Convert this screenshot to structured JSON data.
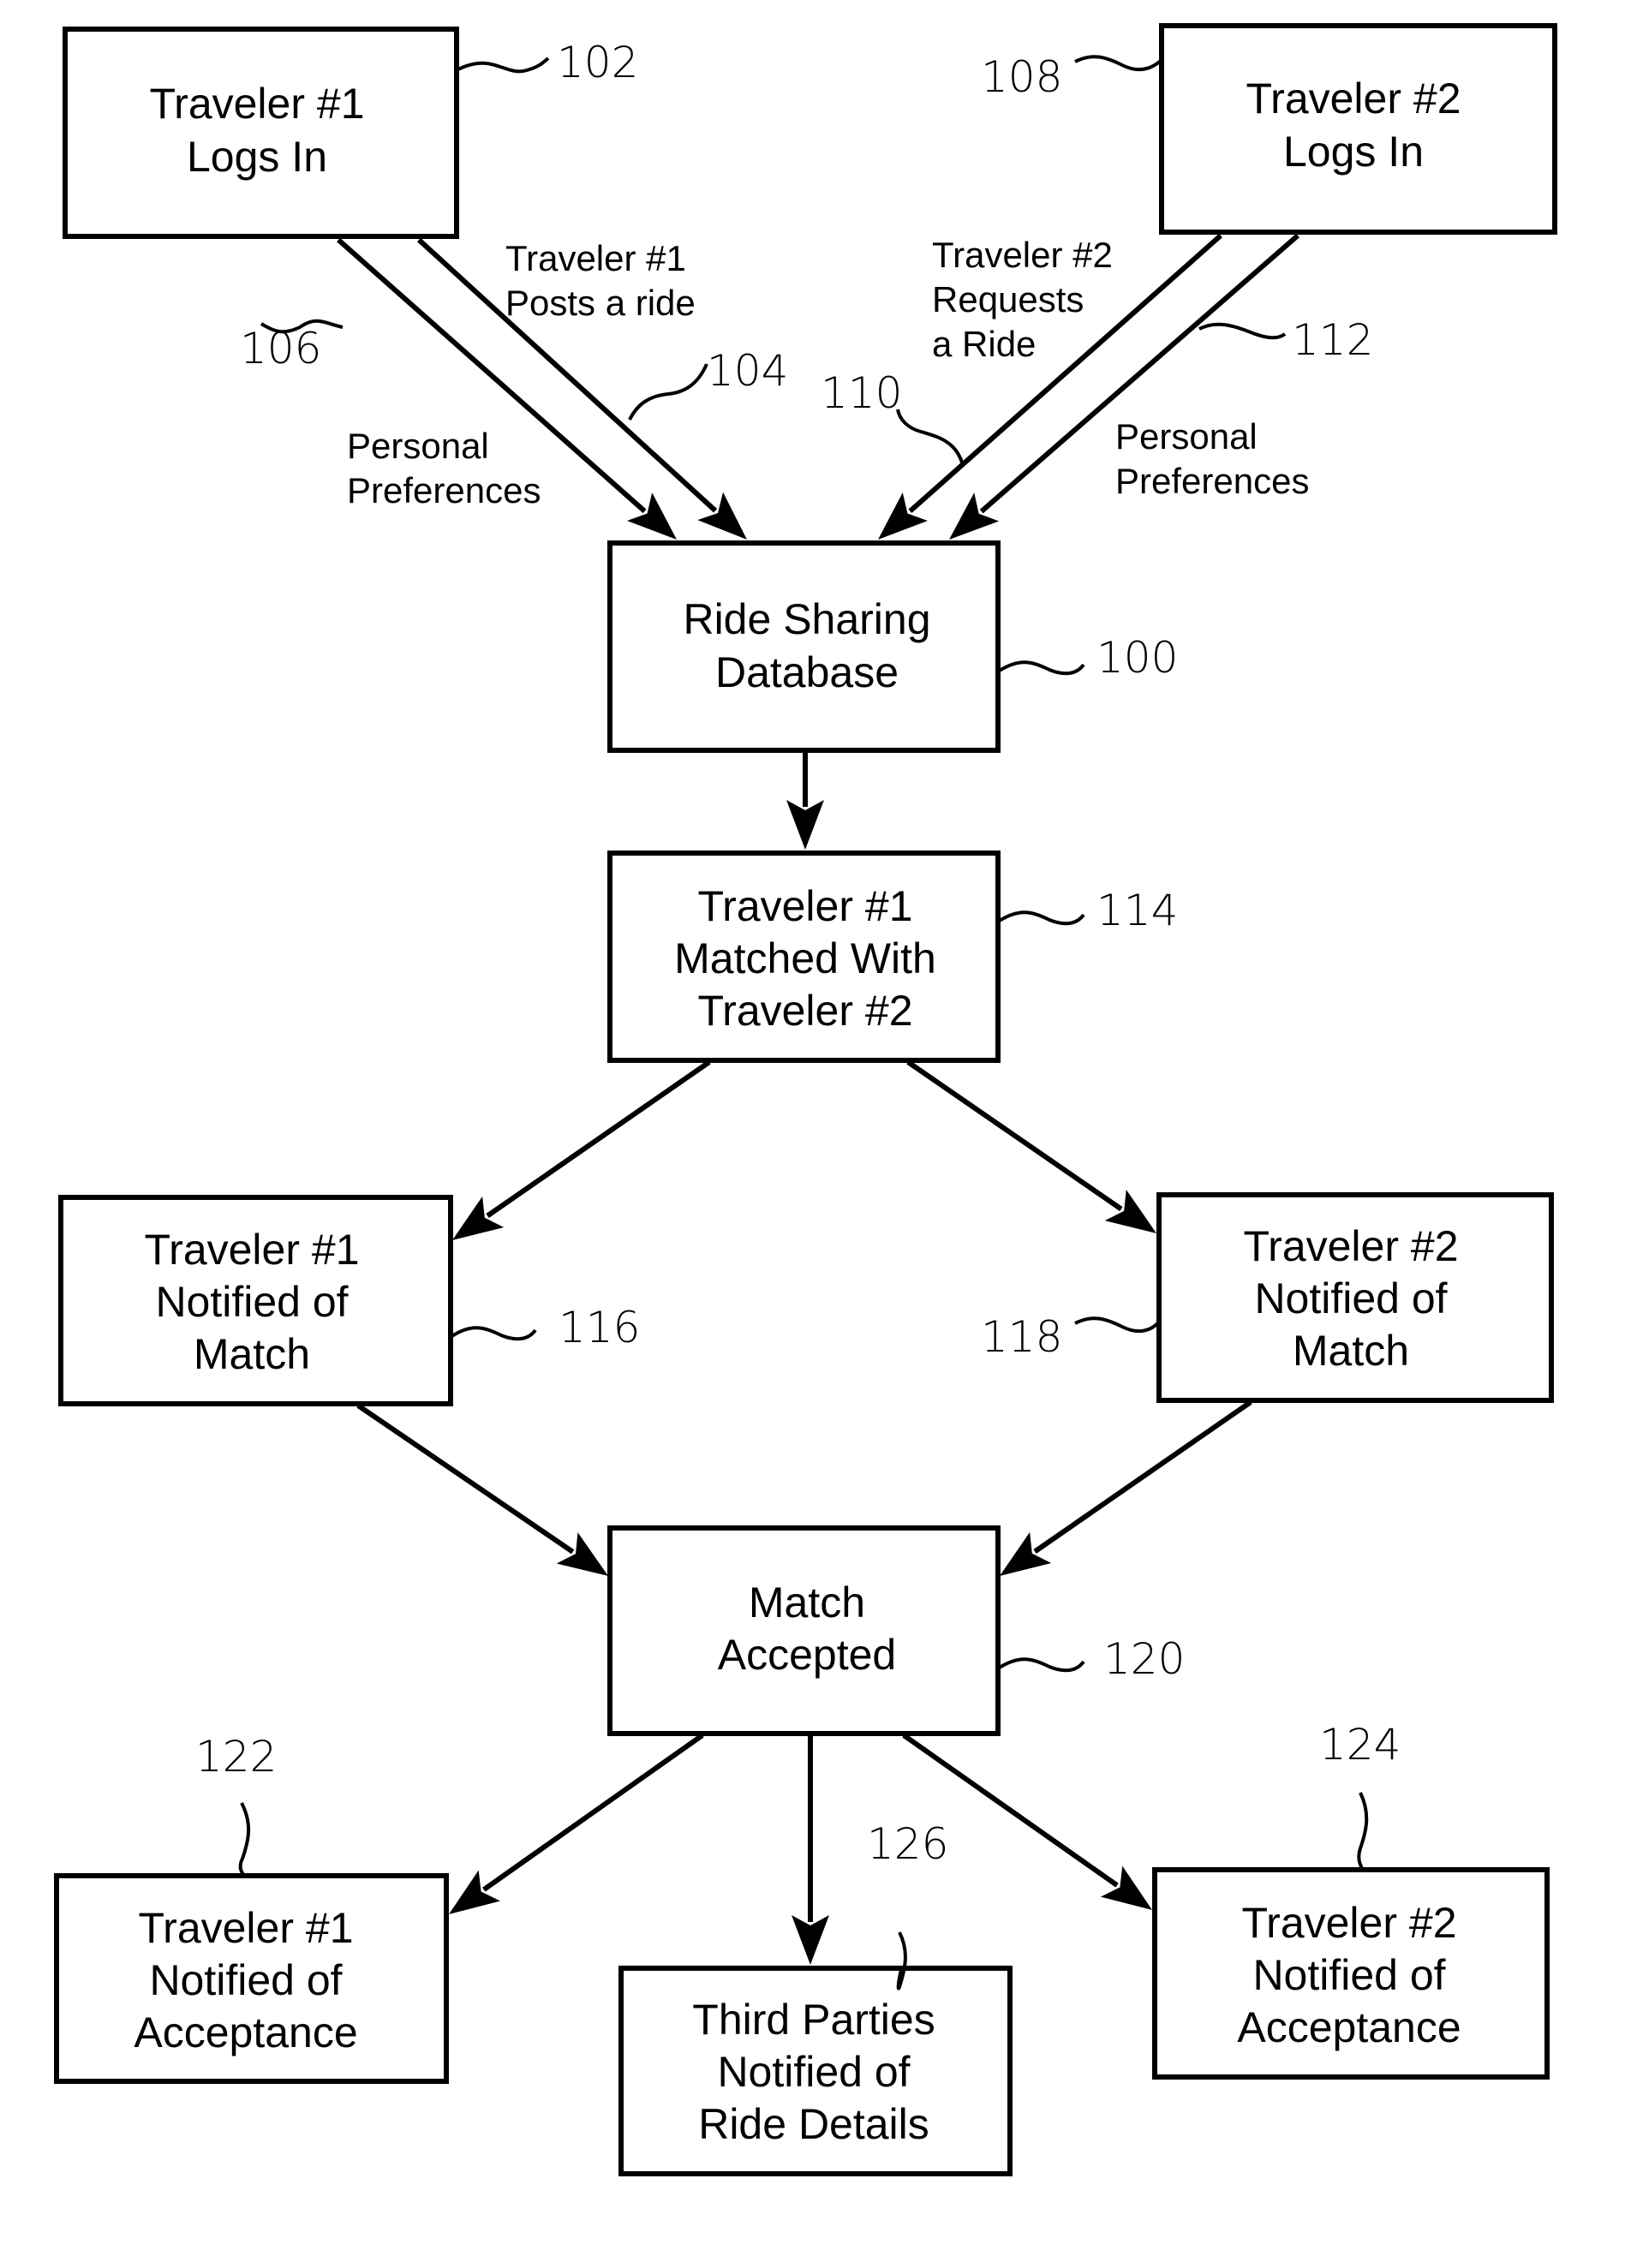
{
  "diagram": {
    "type": "flowchart",
    "nodes": [
      {
        "id": "102",
        "lines": [
          "Traveler #1",
          "Logs In"
        ]
      },
      {
        "id": "108",
        "lines": [
          "Traveler #2",
          "Logs In"
        ]
      },
      {
        "id": "100",
        "lines": [
          "Ride Sharing",
          "Database"
        ]
      },
      {
        "id": "114",
        "lines": [
          "Traveler #1",
          "Matched With",
          "Traveler #2"
        ]
      },
      {
        "id": "116",
        "lines": [
          "Traveler #1",
          "Notified of",
          "Match"
        ]
      },
      {
        "id": "118",
        "lines": [
          "Traveler #2",
          "Notified of",
          "Match"
        ]
      },
      {
        "id": "120",
        "lines": [
          "Match",
          "Accepted"
        ]
      },
      {
        "id": "122",
        "lines": [
          "Traveler #1",
          "Notified of",
          "Acceptance"
        ]
      },
      {
        "id": "126",
        "lines": [
          "Third Parties",
          "Notified of",
          "Ride Details"
        ]
      },
      {
        "id": "124",
        "lines": [
          "Traveler #2",
          "Notified of",
          "Acceptance"
        ]
      }
    ],
    "edge_labels": {
      "posts_ride": [
        "Traveler #1",
        "Posts a ride"
      ],
      "prefs_1": [
        "Personal",
        "Preferences"
      ],
      "requests_ride": [
        "Traveler #2",
        "Requests",
        "a Ride"
      ],
      "prefs_2": [
        "Personal",
        "Preferences"
      ]
    },
    "edge_refs": {
      "r104": "104",
      "r106": "106",
      "r110": "110",
      "r112": "112"
    },
    "edges": [
      {
        "from": "102",
        "to": "100",
        "ref": "104",
        "label": "Traveler #1 Posts a ride"
      },
      {
        "from": "102",
        "to": "100",
        "ref": "106",
        "label": "Personal Preferences"
      },
      {
        "from": "108",
        "to": "100",
        "ref": "110",
        "label": "Traveler #2 Requests a Ride"
      },
      {
        "from": "108",
        "to": "100",
        "ref": "112",
        "label": "Personal Preferences"
      },
      {
        "from": "100",
        "to": "114"
      },
      {
        "from": "114",
        "to": "116"
      },
      {
        "from": "114",
        "to": "118"
      },
      {
        "from": "116",
        "to": "120"
      },
      {
        "from": "118",
        "to": "120"
      },
      {
        "from": "120",
        "to": "122"
      },
      {
        "from": "120",
        "to": "126"
      },
      {
        "from": "120",
        "to": "124"
      }
    ]
  }
}
